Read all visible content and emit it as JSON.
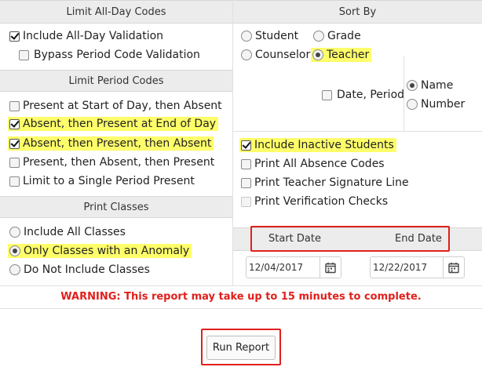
{
  "left": {
    "all_day_header": "Limit All-Day Codes",
    "include_all_day_validation": "Include All-Day Validation",
    "bypass_period_code_validation": "Bypass Period Code Validation",
    "period_header": "Limit Period Codes",
    "period_options": [
      "Present at Start of Day, then Absent",
      "Absent, then Present at End of Day",
      "Absent, then Present, then Absent",
      "Present, then Absent, then Present",
      "Limit to a Single Period Present"
    ],
    "print_classes_header": "Print Classes",
    "class_options": [
      "Include All Classes",
      "Only Classes with an Anomaly",
      "Do Not Include Classes"
    ]
  },
  "right": {
    "sort_header": "Sort By",
    "sort_student": "Student",
    "sort_grade": "Grade",
    "sort_counselor": "Counselor",
    "sort_teacher": "Teacher",
    "date_period": "Date, Period",
    "sub_name": "Name",
    "sub_number": "Number",
    "include_inactive": "Include Inactive Students",
    "print_all_absence": "Print All Absence Codes",
    "print_teacher_signature": "Print Teacher Signature Line",
    "print_verification": "Print Verification Checks",
    "start_date_label": "Start Date",
    "end_date_label": "End Date",
    "start_date_value": "12/04/2017",
    "end_date_value": "12/22/2017"
  },
  "warning": "WARNING: This report may take up to 15 minutes to complete.",
  "run_report": "Run Report",
  "colors": {
    "highlight": "#fefe6a",
    "warning_red": "#e0201c",
    "band_gray": "#ececec"
  }
}
